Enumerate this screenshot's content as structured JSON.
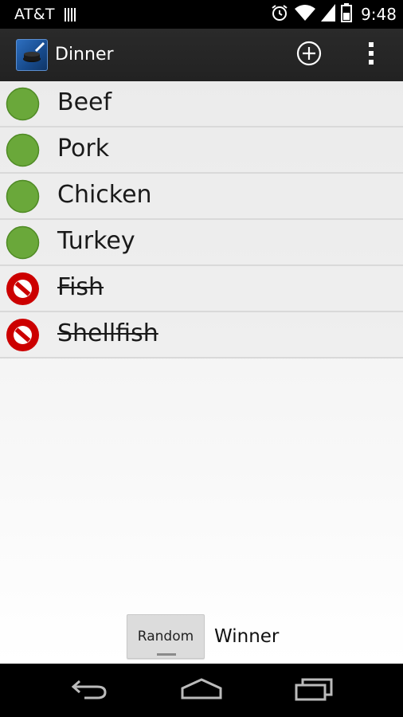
{
  "status_bar": {
    "carrier": "AT&T",
    "time": "9:48"
  },
  "action_bar": {
    "title": "Dinner"
  },
  "items": [
    {
      "label": "Beef",
      "status": "included"
    },
    {
      "label": "Pork",
      "status": "included"
    },
    {
      "label": "Chicken",
      "status": "included"
    },
    {
      "label": "Turkey",
      "status": "included"
    },
    {
      "label": "Fish",
      "status": "excluded"
    },
    {
      "label": "Shellfish",
      "status": "excluded"
    }
  ],
  "bottom": {
    "random_label": "Random",
    "winner_text": "Winner"
  },
  "colors": {
    "included": "#6aa83a",
    "excluded": "#cc0000",
    "action_bar": "#222222",
    "content_bg": "#f0f0f0"
  },
  "icons": {
    "add": "add-circle-icon",
    "overflow": "overflow-menu-icon",
    "back": "back-icon",
    "home": "home-icon",
    "recents": "recent-apps-icon",
    "alarm": "alarm-icon",
    "wifi": "wifi-icon",
    "signal": "signal-icon",
    "battery": "battery-icon"
  }
}
